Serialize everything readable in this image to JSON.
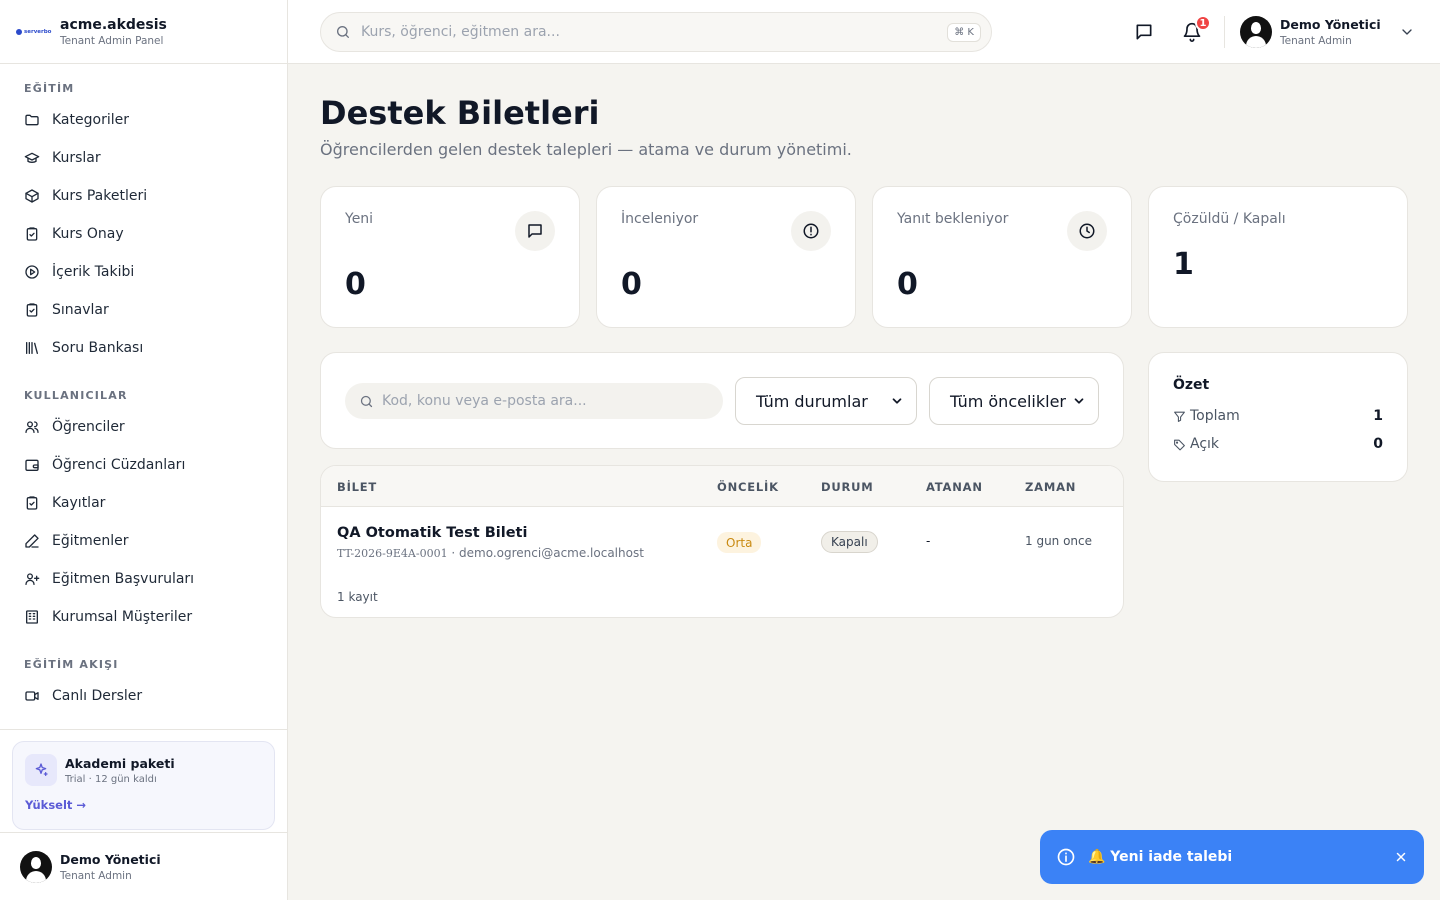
{
  "brand": {
    "logo_text": "serverbo",
    "name": "acme.akdesis",
    "subtitle": "Tenant Admin Panel"
  },
  "sidebar": {
    "sections": [
      {
        "title": "EĞİTİM",
        "items": [
          {
            "label": "Kategoriler",
            "icon": "folder-icon"
          },
          {
            "label": "Kurslar",
            "icon": "graduation-cap-icon"
          },
          {
            "label": "Kurs Paketleri",
            "icon": "package-icon"
          },
          {
            "label": "Kurs Onay",
            "icon": "clipboard-check-icon"
          },
          {
            "label": "İçerik Takibi",
            "icon": "play-circle-icon"
          },
          {
            "label": "Sınavlar",
            "icon": "clipboard-check-icon"
          },
          {
            "label": "Soru Bankası",
            "icon": "library-icon"
          }
        ]
      },
      {
        "title": "KULLANICILAR",
        "items": [
          {
            "label": "Öğrenciler",
            "icon": "users-icon"
          },
          {
            "label": "Öğrenci Cüzdanları",
            "icon": "wallet-icon"
          },
          {
            "label": "Kayıtlar",
            "icon": "clipboard-check-icon"
          },
          {
            "label": "Eğitmenler",
            "icon": "pen-icon"
          },
          {
            "label": "Eğitmen Başvuruları",
            "icon": "user-plus-icon"
          },
          {
            "label": "Kurumsal Müşteriler",
            "icon": "building-icon"
          }
        ]
      },
      {
        "title": "EĞİTİM AKIŞI",
        "items": [
          {
            "label": "Canlı Dersler",
            "icon": "video-icon"
          }
        ]
      }
    ],
    "plan": {
      "title": "Akademi paketi",
      "subtitle": "Trial · 12 gün kaldı",
      "link": "Yükselt →"
    },
    "user": {
      "name": "Demo Yönetici",
      "role": "Tenant Admin"
    }
  },
  "topbar": {
    "search_placeholder": "Kurs, öğrenci, eğitmen ara...",
    "shortcut": "⌘ K",
    "notification_count": "1",
    "user": {
      "name": "Demo Yönetici",
      "role": "Tenant Admin"
    }
  },
  "page": {
    "title": "Destek Biletleri",
    "subtitle": "Öğrencilerden gelen destek talepleri — atama ve durum yönetimi."
  },
  "stats": [
    {
      "label": "Yeni",
      "value": "0",
      "icon": "message-square-icon"
    },
    {
      "label": "İnceleniyor",
      "value": "0",
      "icon": "alert-circle-icon"
    },
    {
      "label": "Yanıt bekleniyor",
      "value": "0",
      "icon": "clock-icon"
    },
    {
      "label": "Çözüldü / Kapalı",
      "value": "1"
    }
  ],
  "filters": {
    "search_placeholder": "Kod, konu veya e-posta ara...",
    "status_select": "Tüm durumlar",
    "priority_select": "Tüm öncelikler"
  },
  "table": {
    "headers": [
      "BİLET",
      "ÖNCELİK",
      "DURUM",
      "ATANAN",
      "ZAMAN"
    ],
    "rows": [
      {
        "title": "QA Otomatik Test Bileti",
        "code": "TT-2026-9E4A-0001",
        "email": "demo.ogrenci@acme.localhost",
        "priority": "Orta",
        "status": "Kapalı",
        "assignee": "-",
        "time": "1 gun once"
      }
    ],
    "count_text": "1 kayıt"
  },
  "summary": {
    "title": "Özet",
    "rows": [
      {
        "label": "Toplam",
        "value": "1",
        "icon": "filter-icon"
      },
      {
        "label": "Açık",
        "value": "0",
        "icon": "tag-icon"
      }
    ]
  },
  "toast": {
    "message": "🔔 Yeni iade talebi"
  },
  "colors": {
    "accent": "#5b5bd6",
    "toast": "#3b82f6",
    "badge": "#ef4444",
    "warning": "#c98a12"
  }
}
